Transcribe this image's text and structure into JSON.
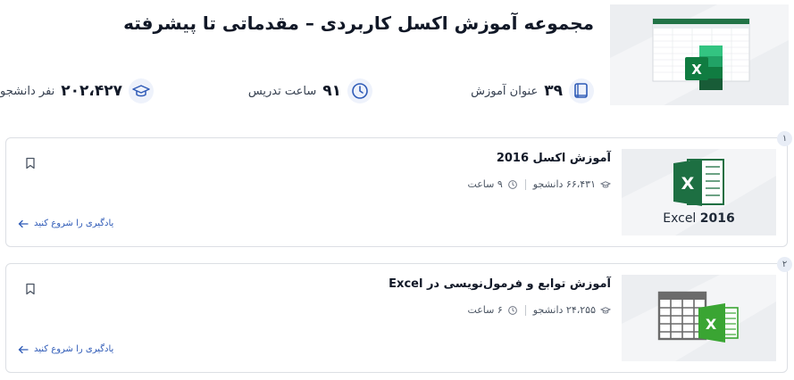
{
  "header": {
    "title": "مجموعه آموزش اکسل کاربردی – مقدماتی تا پیشرفته",
    "stats": {
      "lessons": {
        "value": "۳۹",
        "label": "عنوان آموزش",
        "icon": "book-icon"
      },
      "hours": {
        "value": "۹۱",
        "label": "ساعت تدریس",
        "icon": "clock-icon"
      },
      "students": {
        "value": "۲۰۲،۴۲۷",
        "label": "نفر دانشجو",
        "icon": "graduation-cap-icon"
      }
    }
  },
  "courses": [
    {
      "index": "۱",
      "title": "آموزش اکسل 2016",
      "students": "۶۶،۴۳۱ دانشجو",
      "hours": "۹ ساعت",
      "start_label": "یادگیری را شروع کنید",
      "thumb_caption_light": "Excel",
      "thumb_caption_bold": "2016"
    },
    {
      "index": "۲",
      "title": "آموزش توابع و فرمول‌نویسی در Excel",
      "students": "۲۴،۲۵۵ دانشجو",
      "hours": "۶ ساعت",
      "start_label": "یادگیری را شروع کنید"
    }
  ],
  "colors": {
    "excel_green": "#1d6f42",
    "excel_light_green": "#21a366",
    "link_blue": "#2f5bb7",
    "icon_blue": "#2f5bb7",
    "card_border": "#dcdfe4"
  }
}
